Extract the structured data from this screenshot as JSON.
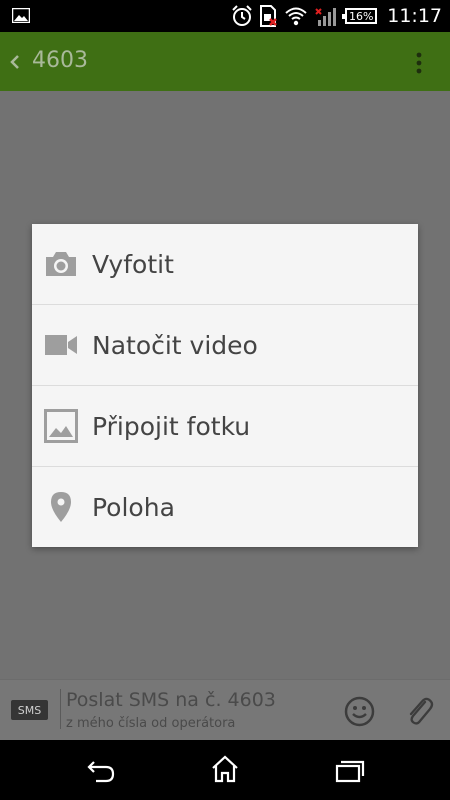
{
  "status_bar": {
    "battery": "16%",
    "time": "11:17"
  },
  "app_bar": {
    "title": "4603"
  },
  "attach_menu": {
    "items": [
      {
        "label": "Vyfotit",
        "icon": "camera-icon"
      },
      {
        "label": "Natočit video",
        "icon": "video-camera-icon"
      },
      {
        "label": "Připojit fotku",
        "icon": "image-icon"
      },
      {
        "label": "Poloha",
        "icon": "location-pin-icon"
      }
    ]
  },
  "compose": {
    "badge": "SMS",
    "placeholder": "Poslat SMS na č. 4603",
    "subtext": "z mého čísla od operátora"
  },
  "colors": {
    "app_bar": "#3f6f14",
    "dialog_bg": "#f5f5f5",
    "scrim": "#727272"
  }
}
